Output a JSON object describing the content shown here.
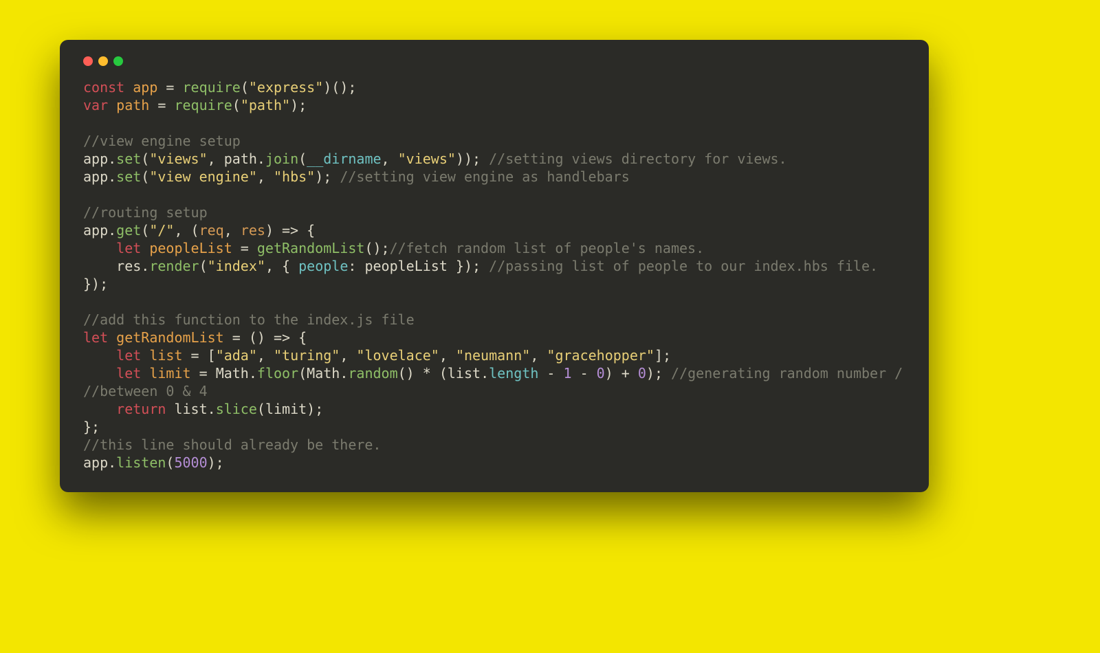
{
  "colors": {
    "background": "#f3e600",
    "window": "#2b2b27",
    "traffic_red": "#ff5f56",
    "traffic_yellow": "#ffbd2e",
    "traffic_green": "#27c93f"
  },
  "traffic": {
    "red": "close",
    "yellow": "minimize",
    "green": "zoom"
  },
  "tokens": {
    "l1_const": "const",
    "l1_app": "app",
    "l1_eq": " = ",
    "l1_require": "require",
    "l1_open": "(",
    "l1_str": "\"express\"",
    "l1_close": ")();",
    "l2_var": "var",
    "l2_path": "path",
    "l2_eq": " = ",
    "l2_require": "require",
    "l2_open": "(",
    "l2_str": "\"path\"",
    "l2_close": ");",
    "l3_blank": "",
    "l4_cmt": "//view engine setup",
    "l5_app": "app",
    "l5_dot": ".",
    "l5_set": "set",
    "l5_open": "(",
    "l5_str1": "\"views\"",
    "l5_comma": ", ",
    "l5_path": "path",
    "l5_dot2": ".",
    "l5_join": "join",
    "l5_open2": "(",
    "l5_dirname": "__dirname",
    "l5_comma2": ", ",
    "l5_str2": "\"views\"",
    "l5_close": ")); ",
    "l5_cmt": "//setting views directory for views.",
    "l6_app": "app",
    "l6_dot": ".",
    "l6_set": "set",
    "l6_open": "(",
    "l6_str1": "\"view engine\"",
    "l6_comma": ", ",
    "l6_str2": "\"hbs\"",
    "l6_close": "); ",
    "l6_cmt": "//setting view engine as handlebars",
    "l7_blank": "",
    "l8_cmt": "//routing setup",
    "l9_app": "app",
    "l9_dot": ".",
    "l9_get": "get",
    "l9_open": "(",
    "l9_str": "\"/\"",
    "l9_comma": ", (",
    "l9_req": "req",
    "l9_comma2": ", ",
    "l9_res": "res",
    "l9_arrow": ") => {",
    "l10_indent": "    ",
    "l10_let": "let",
    "l10_pl": "peopleList",
    "l10_eq": " = ",
    "l10_fn": "getRandomList",
    "l10_call": "();",
    "l10_cmt": "//fetch random list of people's names.",
    "l11_indent": "    ",
    "l11_res": "res",
    "l11_dot": ".",
    "l11_render": "render",
    "l11_open": "(",
    "l11_str": "\"index\"",
    "l11_comma": ", { ",
    "l11_people": "people",
    "l11_colon": ": ",
    "l11_pl": "peopleList",
    "l11_close": " }); ",
    "l11_cmt": "//passing list of people to our index.hbs file.",
    "l12_close": "});",
    "l13_blank": "",
    "l14_cmt": "//add this function to the index.js file",
    "l15_let": "let",
    "l15_name": "getRandomList",
    "l15_eq": " = () => {",
    "l16_indent": "    ",
    "l16_let": "let",
    "l16_list": "list",
    "l16_eq": " = [",
    "l16_s1": "\"ada\"",
    "l16_c1": ", ",
    "l16_s2": "\"turing\"",
    "l16_c2": ", ",
    "l16_s3": "\"lovelace\"",
    "l16_c3": ", ",
    "l16_s4": "\"neumann\"",
    "l16_c4": ", ",
    "l16_s5": "\"gracehopper\"",
    "l16_end": "];",
    "l17_indent": "    ",
    "l17_let": "let",
    "l17_limit": "limit",
    "l17_eq": " = ",
    "l17_math1": "Math",
    "l17_dot1": ".",
    "l17_floor": "floor",
    "l17_open": "(",
    "l17_math2": "Math",
    "l17_dot2": ".",
    "l17_random": "random",
    "l17_call": "() * (",
    "l17_list": "list",
    "l17_dot3": ".",
    "l17_len": "length",
    "l17_m1": " - ",
    "l17_n1": "1",
    "l17_m2": " - ",
    "l17_n0a": "0",
    "l17_p1": ") + ",
    "l17_n0b": "0",
    "l17_close": "); ",
    "l17_cmt": "//generating random number /",
    "l18_cmt": "//between 0 & 4",
    "l19_indent": "    ",
    "l19_return": "return",
    "l19_sp": " ",
    "l19_list": "list",
    "l19_dot": ".",
    "l19_slice": "slice",
    "l19_open": "(",
    "l19_limit": "limit",
    "l19_close": ");",
    "l20_close": "};",
    "l21_cmt": "//this line should already be there.",
    "l22_app": "app",
    "l22_dot": ".",
    "l22_listen": "listen",
    "l22_open": "(",
    "l22_num": "5000",
    "l22_close": ");"
  }
}
